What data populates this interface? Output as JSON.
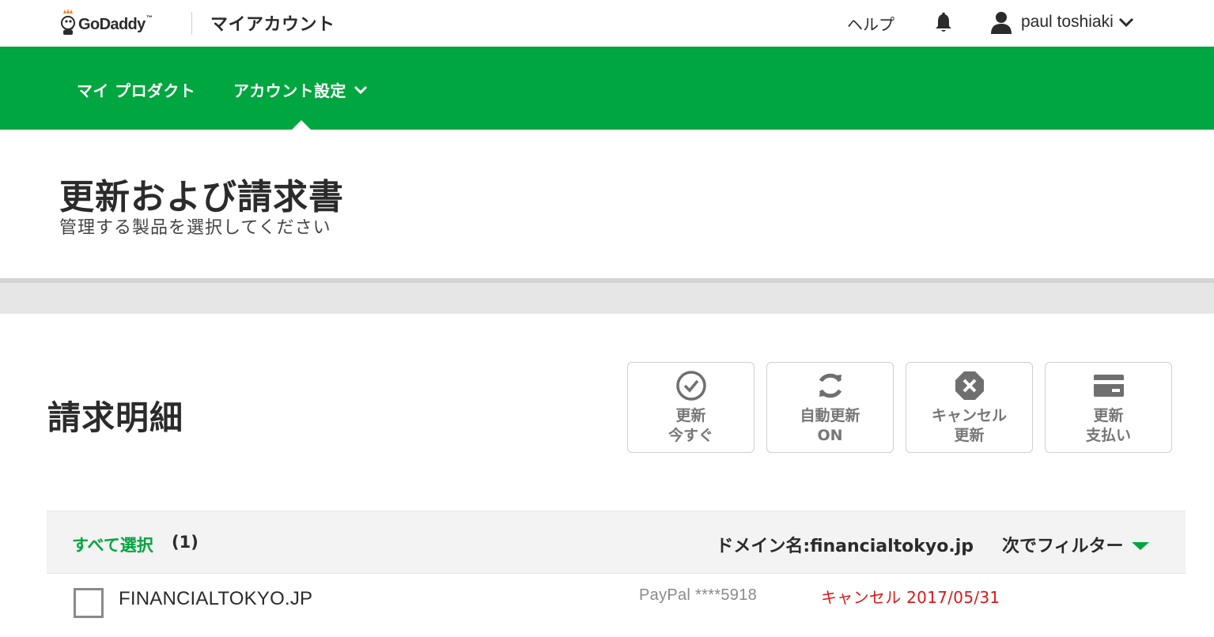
{
  "header": {
    "logo_text": "GoDaddy",
    "logo_tm": "™",
    "app_title": "マイアカウント",
    "help_label": "ヘルプ",
    "user_name": "paul toshiaki"
  },
  "nav": {
    "items": [
      {
        "label": "マイ プロダクト"
      },
      {
        "label": "アカウント設定"
      }
    ],
    "colors": {
      "bar": "#00a63f"
    }
  },
  "page": {
    "title": "更新および請求書",
    "subtitle": "管理する製品を選択してください"
  },
  "section": {
    "title": "請求明細"
  },
  "actions": [
    {
      "line1": "更新",
      "line2": "今すぐ",
      "icon": "check-circle-icon"
    },
    {
      "line1": "自動更新",
      "line2": "ON",
      "icon": "refresh-icon"
    },
    {
      "line1": "キャンセル",
      "line2": "更新",
      "icon": "cancel-x-icon"
    },
    {
      "line1": "更新",
      "line2": "支払い",
      "icon": "credit-card-icon"
    }
  ],
  "filter": {
    "select_all": "すべて選択",
    "count": "(1)",
    "domain_filter": "ドメイン名:financialtokyo.jp",
    "filter_by": "次でフィルター"
  },
  "rows": [
    {
      "domain": "FINANCIALTOKYO.JP",
      "payment": "PayPal ****5918",
      "status": "キャンセル 2017/05/31",
      "checked": false
    }
  ],
  "colors": {
    "brand_green": "#00a63f",
    "status_red": "#d91818"
  }
}
